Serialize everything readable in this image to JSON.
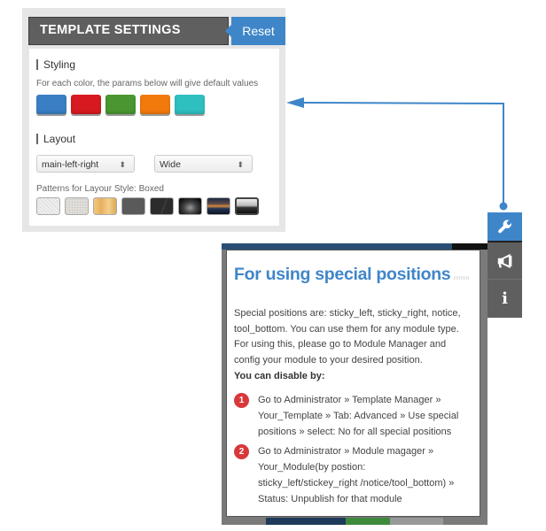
{
  "template_settings": {
    "title": "TEMPLATE SETTINGS",
    "reset_label": "Reset",
    "styling": {
      "heading": "Styling",
      "hint": "For each color, the params below will give default values",
      "colors": [
        {
          "name": "blue",
          "hex": "#3a7fc4"
        },
        {
          "name": "red",
          "hex": "#d71a20"
        },
        {
          "name": "green",
          "hex": "#4a9630"
        },
        {
          "name": "orange",
          "hex": "#f27a0c"
        },
        {
          "name": "cyan",
          "hex": "#2ebfbf"
        }
      ]
    },
    "layout": {
      "heading": "Layout",
      "position_select": "main-left-right",
      "width_select": "Wide",
      "patterns_label": "Patterns for Layour Style: Boxed",
      "patterns": [
        "white-linen",
        "light-stone",
        "wood",
        "dark-grey",
        "charcoal",
        "dark-photo-1",
        "sunset-photo",
        "city-photo"
      ]
    }
  },
  "sidebar": {
    "items": [
      {
        "icon": "wrench-icon",
        "glyph": "🔧",
        "active": true
      },
      {
        "icon": "megaphone-icon",
        "glyph": "📢",
        "active": false
      },
      {
        "icon": "info-icon",
        "glyph": "i",
        "active": false
      }
    ]
  },
  "popup": {
    "title": "For using special positions",
    "intro": "Special positions are: sticky_left, sticky_right, notice, tool_bottom. You can use them for any module type. For using this, please go to Module Manager and config your module to your desired position.",
    "subheading": "You can disable by:",
    "steps": [
      {
        "num": "1",
        "text": "Go to Administrator » Template Manager » Your_Template » Tab: Advanced » Use special positions » select: No for all special positions"
      },
      {
        "num": "2",
        "text": "Go to Administrator » Module magager » Your_Module(by postion: sticky_left/stickey_right /notice/tool_bottom) » Status: Unpublish for that module"
      }
    ]
  },
  "colors": {
    "accent": "#3f86c9",
    "header_dark": "#5f5f5f",
    "step_badge": "#d9383a"
  }
}
